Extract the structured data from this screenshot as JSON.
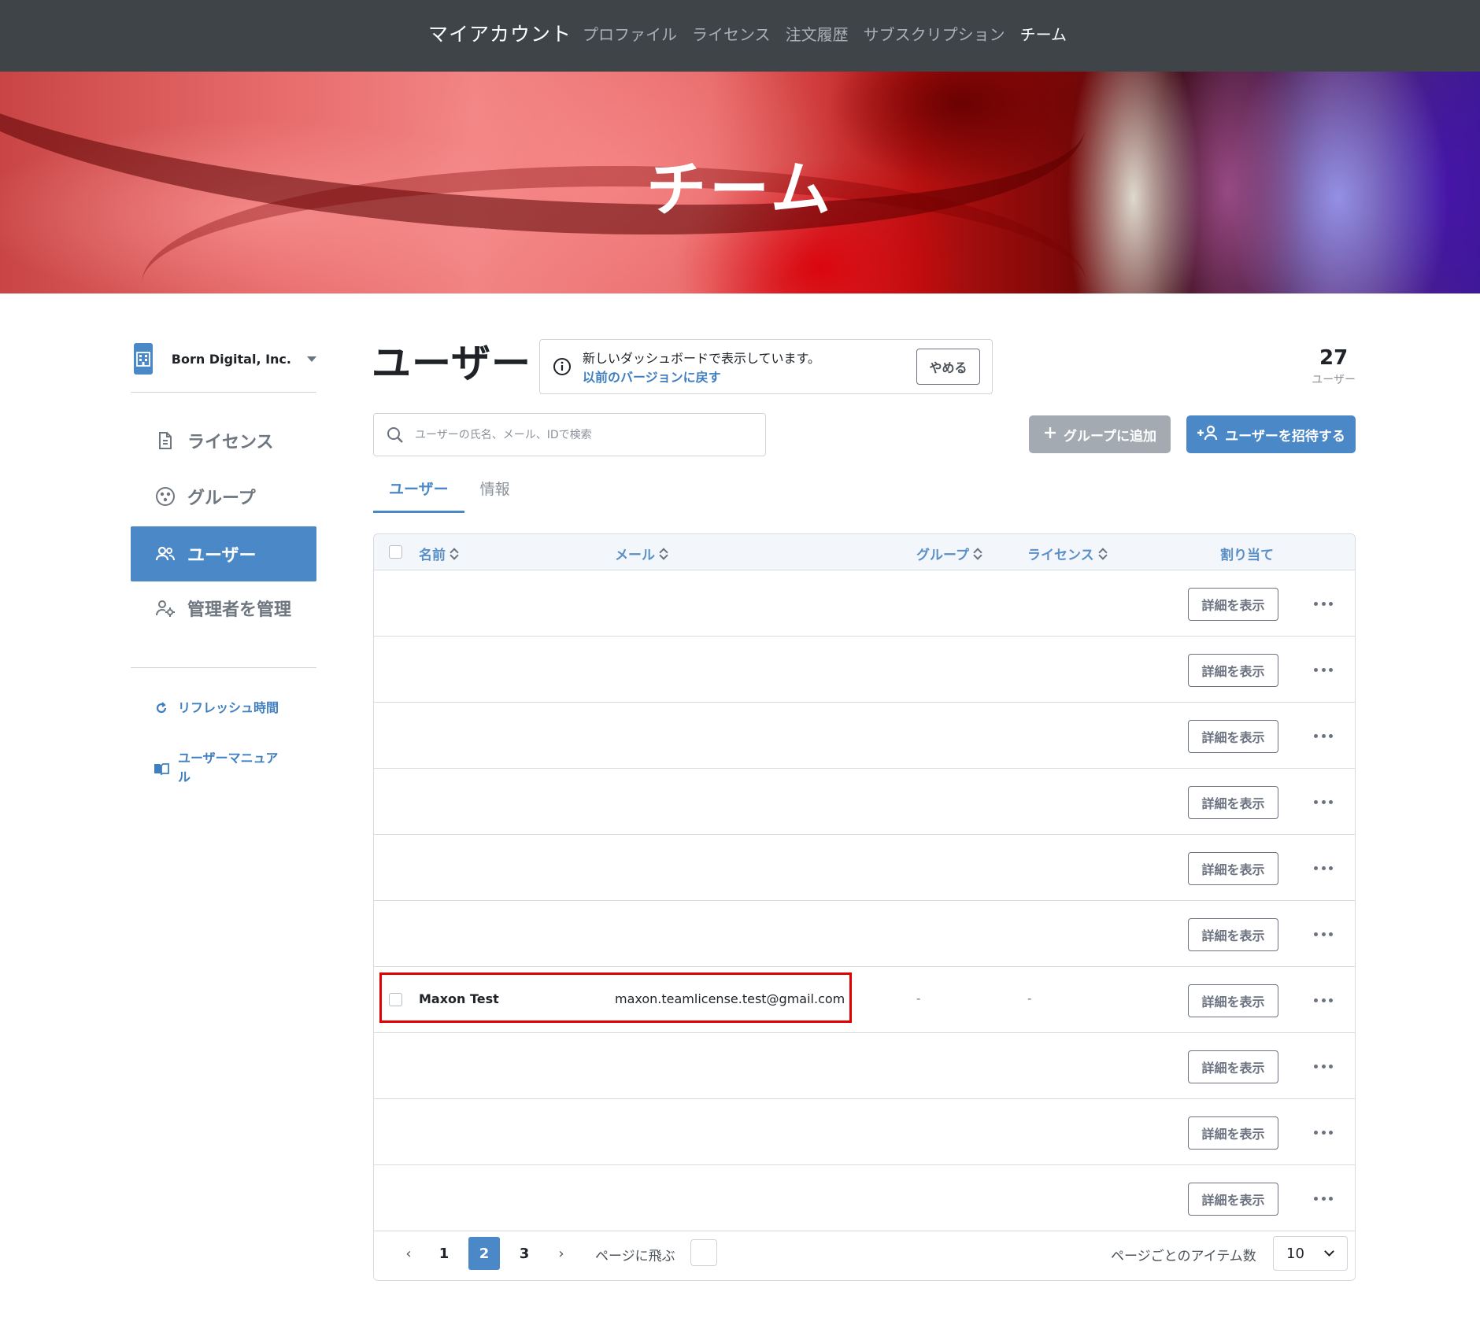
{
  "topnav": {
    "brand": "マイアカウント",
    "links": [
      "プロファイル",
      "ライセンス",
      "注文履歴",
      "サブスクリプション",
      "チーム"
    ],
    "active": "チーム"
  },
  "hero": {
    "title": "チーム"
  },
  "sidebar": {
    "org_name": "Born Digital, Inc.",
    "items": [
      {
        "label": "ライセンス",
        "icon": "document-icon"
      },
      {
        "label": "グループ",
        "icon": "group-icon"
      },
      {
        "label": "ユーザー",
        "icon": "users-icon",
        "active": true
      },
      {
        "label": "管理者を管理",
        "icon": "admin-gear-icon"
      }
    ],
    "links": [
      {
        "label": "リフレッシュ時間",
        "icon": "refresh-icon"
      },
      {
        "label": "ユーザーマニュアル",
        "icon": "book-icon"
      }
    ]
  },
  "main": {
    "title": "ユーザー",
    "notice": {
      "message": "新しいダッシュボードで表示しています。",
      "revert_link": "以前のバージョンに戻す",
      "stop_button": "やめる"
    },
    "user_count": "27",
    "user_count_unit": "ユーザー",
    "search_placeholder": "ユーザーの氏名、メール、IDで検索",
    "add_to_group_button": "グループに追加",
    "invite_button": "ユーザーを招待する",
    "tabs": [
      "ユーザー",
      "情報"
    ],
    "active_tab": "ユーザー"
  },
  "table": {
    "headers": {
      "name": "名前",
      "email": "メール",
      "group": "グループ",
      "license": "ライセンス",
      "assign": "割り当て"
    },
    "detail_button": "詳細を表示",
    "rows": [
      {
        "name": "",
        "email": "",
        "group": "",
        "license": ""
      },
      {
        "name": "",
        "email": "",
        "group": "",
        "license": ""
      },
      {
        "name": "",
        "email": "",
        "group": "",
        "license": ""
      },
      {
        "name": "",
        "email": "",
        "group": "",
        "license": ""
      },
      {
        "name": "",
        "email": "",
        "group": "",
        "license": ""
      },
      {
        "name": "",
        "email": "",
        "group": "",
        "license": ""
      },
      {
        "name": "Maxon Test",
        "email": "maxon.teamlicense.test@gmail.com",
        "group": "-",
        "license": "-"
      },
      {
        "name": "",
        "email": "",
        "group": "",
        "license": ""
      },
      {
        "name": "",
        "email": "",
        "group": "",
        "license": ""
      },
      {
        "name": "",
        "email": "",
        "group": "",
        "license": ""
      }
    ]
  },
  "pagination": {
    "prev": "‹",
    "pages": [
      "1",
      "2",
      "3"
    ],
    "current": "2",
    "next": "›",
    "jump_label": "ページに飛ぶ",
    "items_per_page_label": "ページごとのアイテム数",
    "items_per_page": "10"
  },
  "colors": {
    "accent": "#4a88c7",
    "nav_bg": "#3f4449",
    "highlight": "#e00000",
    "disabled_button": "#a3aab1"
  }
}
